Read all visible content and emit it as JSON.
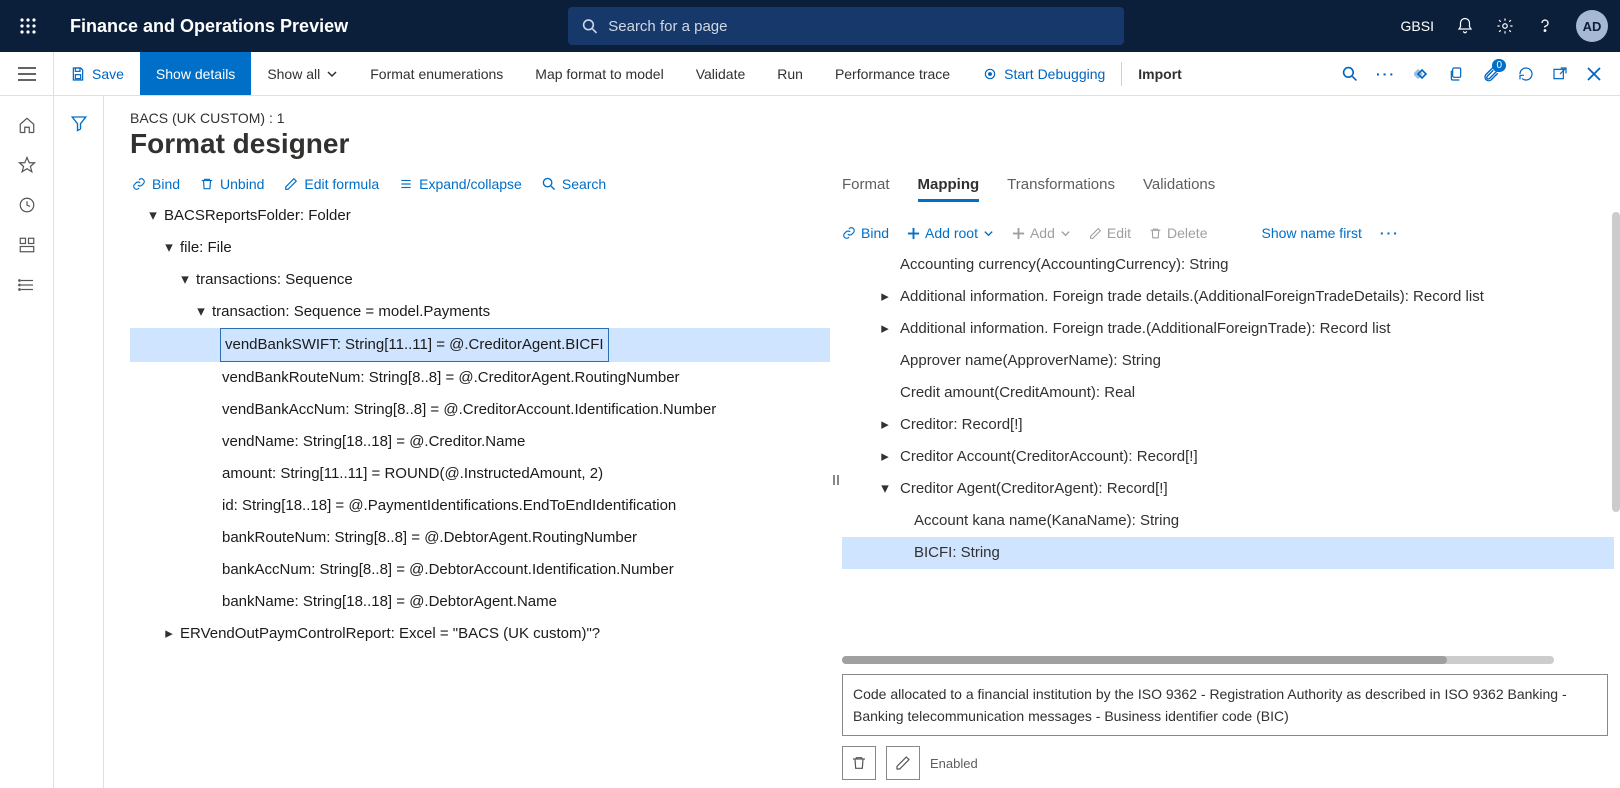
{
  "top": {
    "appTitle": "Finance and Operations Preview",
    "searchPlaceholder": "Search for a page",
    "company": "GBSI",
    "avatar": "AD"
  },
  "cmd": {
    "save": "Save",
    "showDetails": "Show details",
    "showAll": "Show all",
    "formatEnum": "Format enumerations",
    "mapFormat": "Map format to model",
    "validate": "Validate",
    "run": "Run",
    "perfTrace": "Performance trace",
    "startDebug": "Start Debugging",
    "import": "Import",
    "badge": "0"
  },
  "page": {
    "breadcrumb": "BACS (UK CUSTOM) : 1",
    "title": "Format designer"
  },
  "leftToolbar": {
    "bind": "Bind",
    "unbind": "Unbind",
    "editFormula": "Edit formula",
    "expand": "Expand/collapse",
    "search": "Search"
  },
  "tree": {
    "n1": "BACSReportsFolder: Folder",
    "n2": "file: File",
    "n3": "transactions: Sequence",
    "n4": "transaction: Sequence = model.Payments",
    "n5": "vendBankSWIFT: String[11..11] = @.CreditorAgent.BICFI",
    "n6": "vendBankRouteNum: String[8..8] = @.CreditorAgent.RoutingNumber",
    "n7": "vendBankAccNum: String[8..8] = @.CreditorAccount.Identification.Number",
    "n8": "vendName: String[18..18] = @.Creditor.Name",
    "n9": "amount: String[11..11] = ROUND(@.InstructedAmount, 2)",
    "n10": "id: String[18..18] = @.PaymentIdentifications.EndToEndIdentification",
    "n11": "bankRouteNum: String[8..8] = @.DebtorAgent.RoutingNumber",
    "n12": "bankAccNum: String[8..8] = @.DebtorAccount.Identification.Number",
    "n13": "bankName: String[18..18] = @.DebtorAgent.Name",
    "n14": "ERVendOutPaymControlReport: Excel = \"BACS (UK custom)\"?"
  },
  "tabs": {
    "format": "Format",
    "mapping": "Mapping",
    "transformations": "Transformations",
    "validations": "Validations"
  },
  "rightToolbar": {
    "bind": "Bind",
    "addRoot": "Add root",
    "add": "Add",
    "edit": "Edit",
    "delete": "Delete",
    "showName": "Show name first"
  },
  "rtree": {
    "r1": "Accounting currency(AccountingCurrency): String",
    "r2": "Additional information. Foreign trade details.(AdditionalForeignTradeDetails): Record list",
    "r3": "Additional information. Foreign trade.(AdditionalForeignTrade): Record list",
    "r4": "Approver name(ApproverName): String",
    "r5": "Credit amount(CreditAmount): Real",
    "r6": "Creditor: Record[!]",
    "r7": "Creditor Account(CreditorAccount): Record[!]",
    "r8": "Creditor Agent(CreditorAgent): Record[!]",
    "r9": "Account kana name(KanaName): String",
    "r10": "BICFI: String"
  },
  "desc": "Code allocated to a financial institution by the ISO 9362 - Registration Authority as described in ISO 9362 Banking - Banking telecommunication messages - Business identifier code (BIC)",
  "enabled": "Enabled"
}
